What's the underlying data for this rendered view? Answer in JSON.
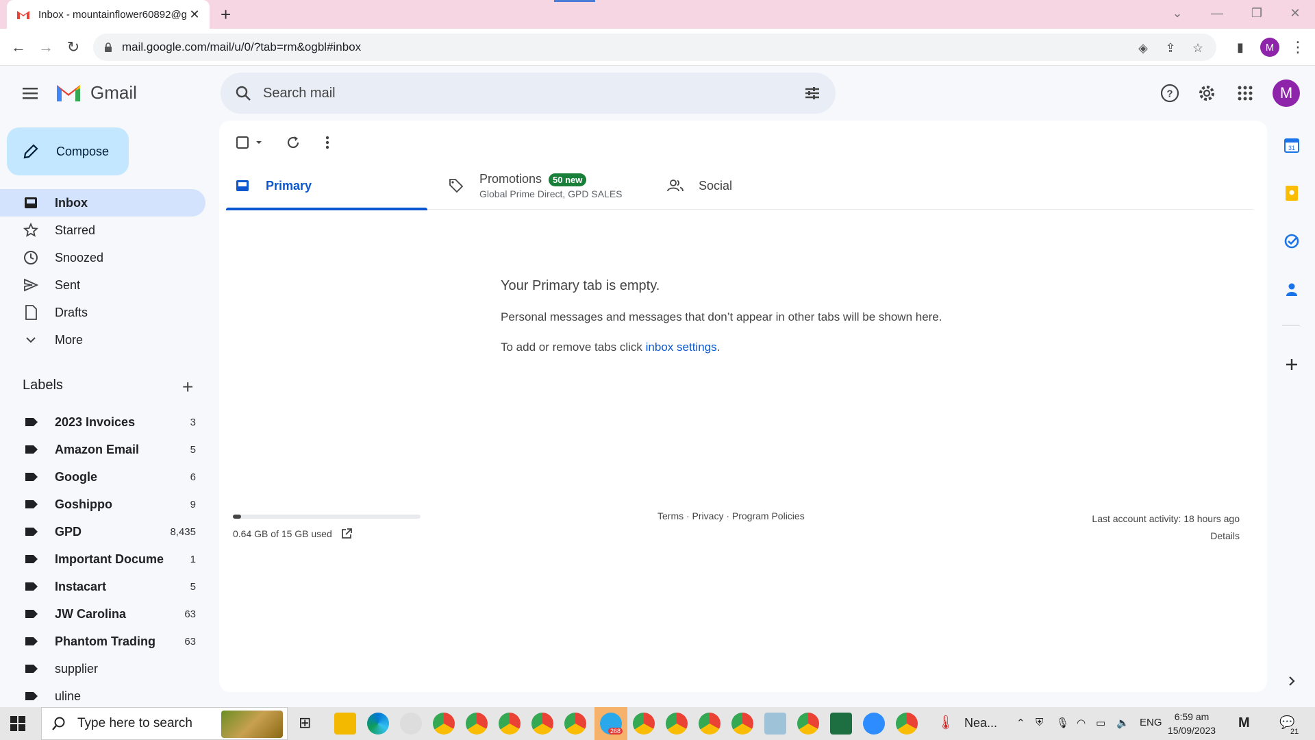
{
  "browser": {
    "tab_title": "Inbox - mountainflower60892@g",
    "url": "mail.google.com/mail/u/0/?tab=rm&ogbl#inbox",
    "profile_initial": "M"
  },
  "gmail": {
    "brand": "Gmail",
    "search_placeholder": "Search mail",
    "avatar_initial": "M"
  },
  "nav": {
    "compose_label": "Compose",
    "items": [
      {
        "label": "Inbox",
        "icon": "inbox-icon"
      },
      {
        "label": "Starred",
        "icon": "star-icon"
      },
      {
        "label": "Snoozed",
        "icon": "clock-icon"
      },
      {
        "label": "Sent",
        "icon": "send-icon"
      },
      {
        "label": "Drafts",
        "icon": "draft-icon"
      },
      {
        "label": "More",
        "icon": "chevron-down-icon"
      }
    ],
    "labels_heading": "Labels",
    "labels": [
      {
        "name": "2023 Invoices",
        "count": "3"
      },
      {
        "name": "Amazon Email",
        "count": "5"
      },
      {
        "name": "Google",
        "count": "6"
      },
      {
        "name": "Goshippo",
        "count": "9"
      },
      {
        "name": "GPD",
        "count": "8,435"
      },
      {
        "name": "Important Docume...",
        "count": "1"
      },
      {
        "name": "Instacart",
        "count": "5"
      },
      {
        "name": "JW Carolina",
        "count": "63"
      },
      {
        "name": "Phantom Trading",
        "count": "63"
      },
      {
        "name": "supplier",
        "count": ""
      },
      {
        "name": "uline",
        "count": ""
      }
    ]
  },
  "tabs": {
    "primary": "Primary",
    "promotions": "Promotions",
    "promotions_badge": "50 new",
    "promotions_sub": "Global Prime Direct, GPD SALES",
    "social": "Social"
  },
  "empty": {
    "title": "Your Primary tab is empty.",
    "text": "Personal messages and messages that don’t appear in other tabs will be shown here.",
    "text2_prefix": "To add or remove tabs click ",
    "text2_link": "inbox settings",
    "text2_suffix": "."
  },
  "footer": {
    "storage": "0.64 GB of 15 GB used",
    "storage_fraction": 0.043,
    "links": "Terms · Privacy · Program Policies",
    "activity": "Last account activity: 18 hours ago",
    "details": "Details"
  },
  "taskbar": {
    "search_placeholder": "Type here to search",
    "weather": "Nea...",
    "lang": "ENG",
    "time": "6:59 am",
    "date": "15/09/2023",
    "telegram_badge": "268",
    "notifications": "21"
  },
  "colors": {
    "accent": "#0b57d0",
    "compose_bg": "#c2e7ff",
    "active_nav": "#d3e3fd",
    "badge": "#188038",
    "avatar": "#8e24aa"
  }
}
